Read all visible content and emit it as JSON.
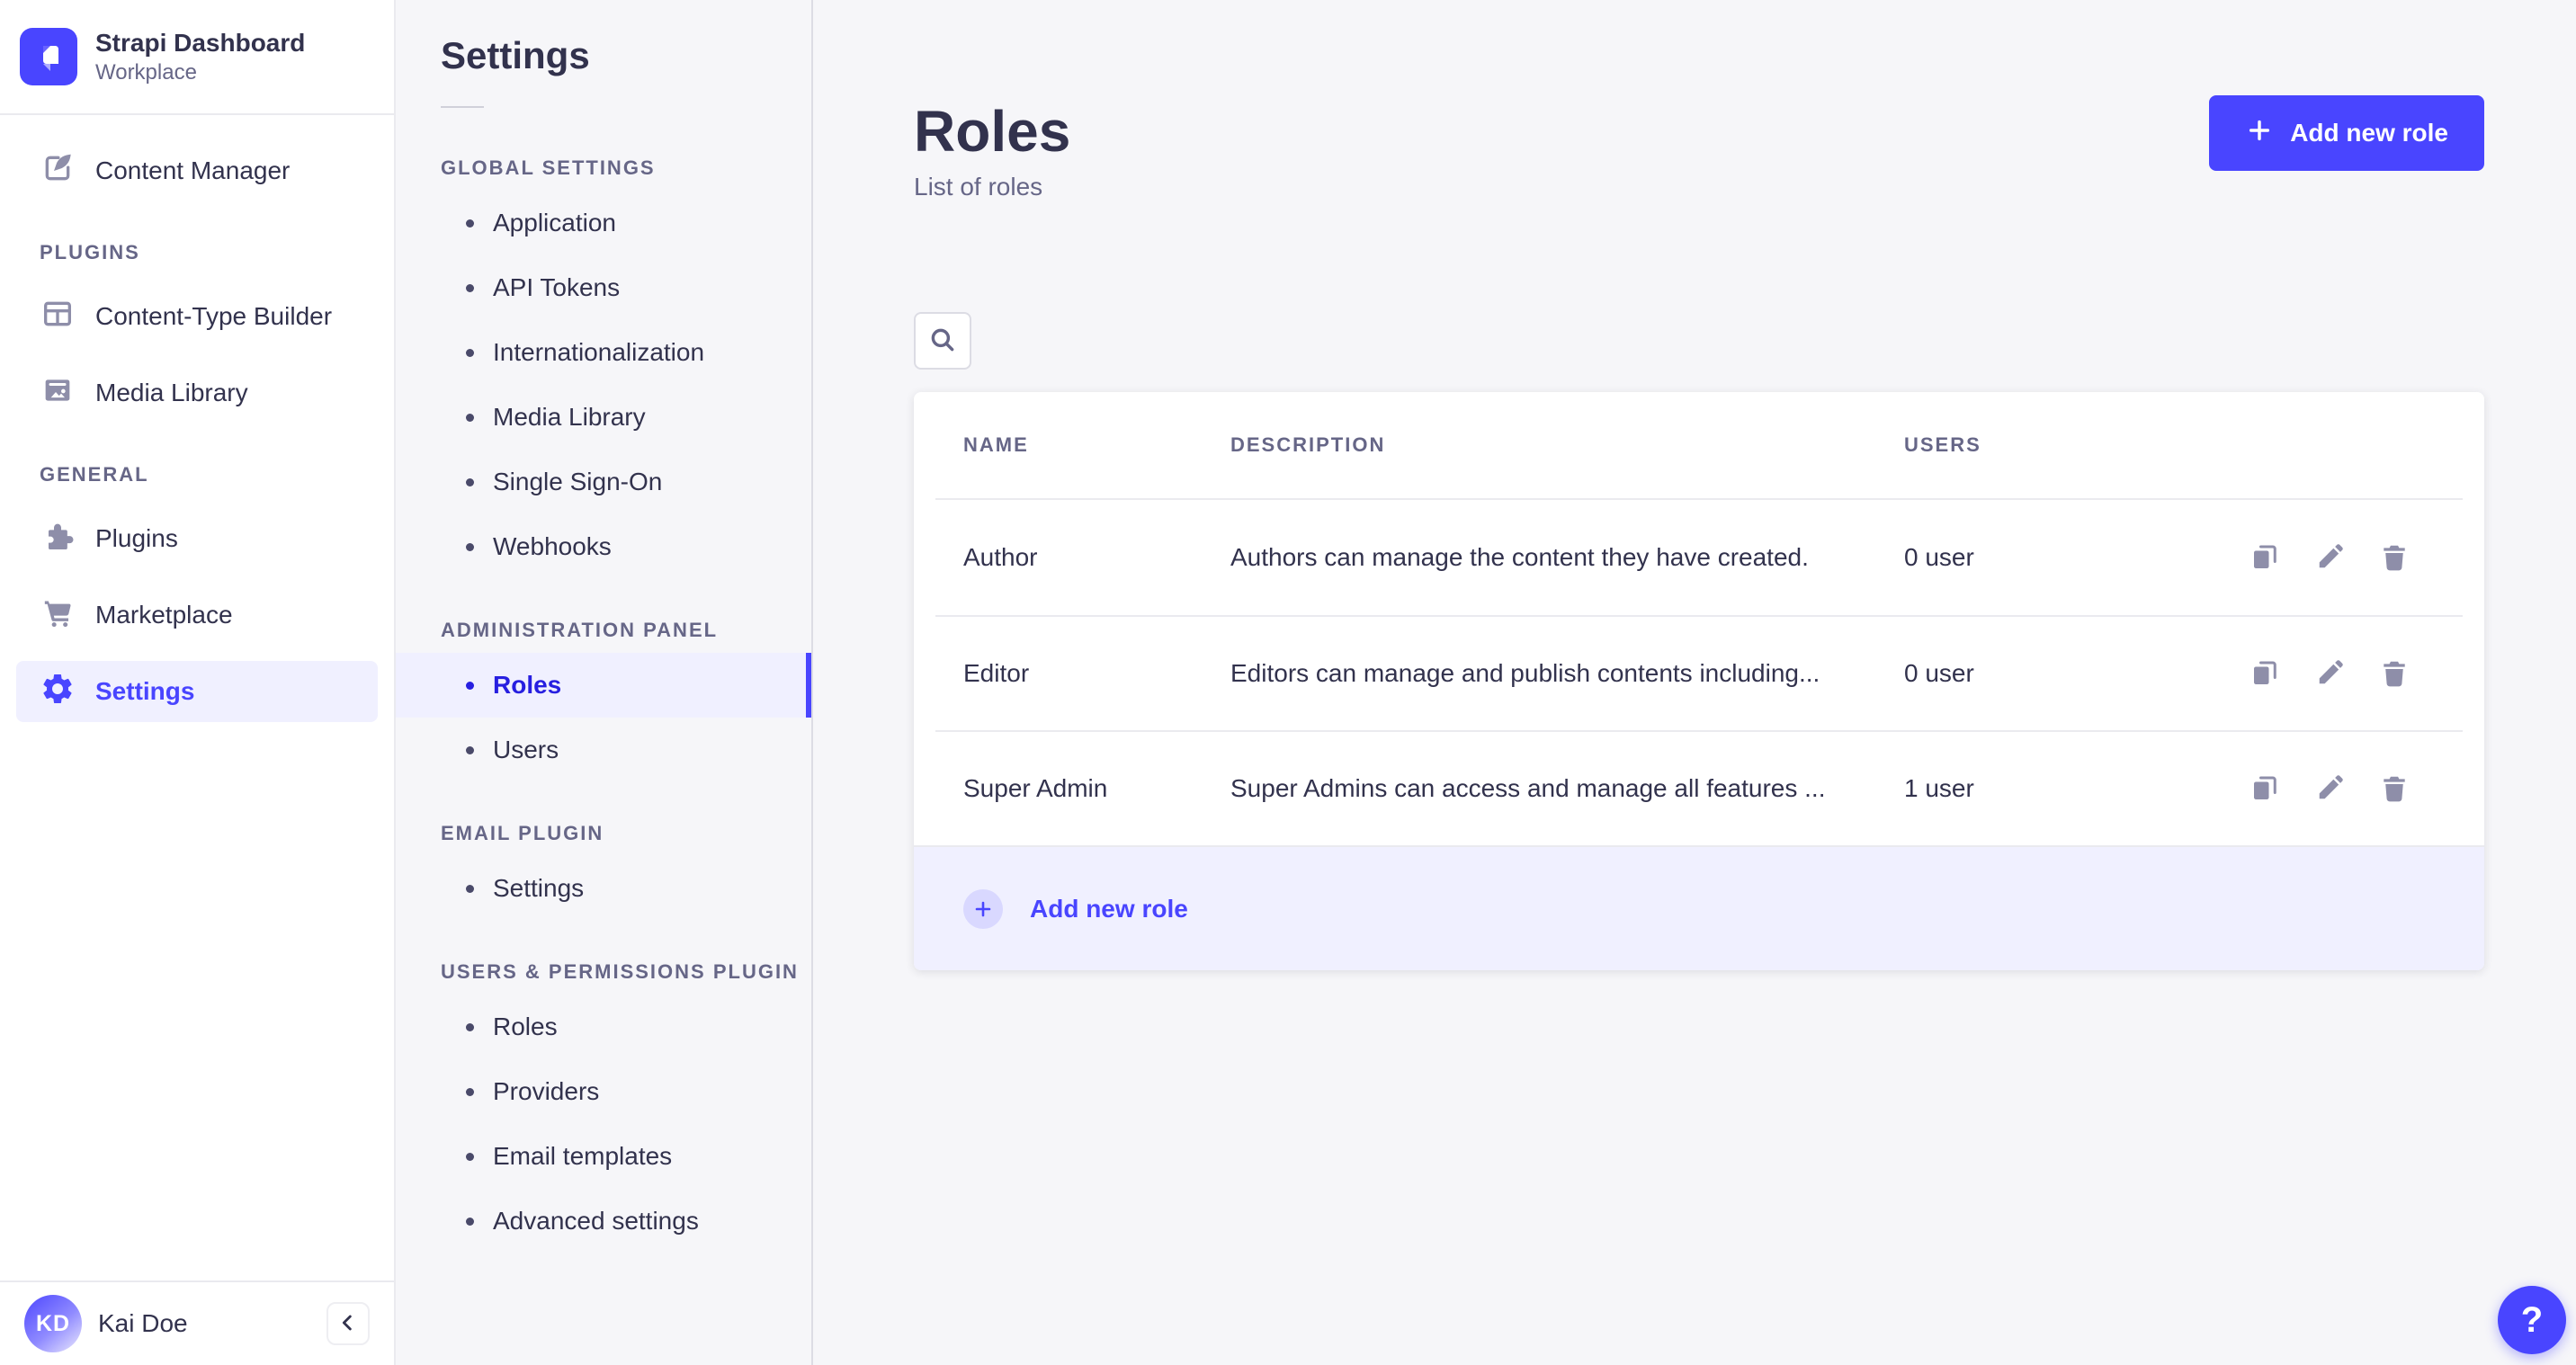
{
  "colors": {
    "accent": "#4945ff",
    "accent_dark": "#271fe0",
    "accent_light_bg": "#f0f0ff",
    "app_bg": "#f6f6f9",
    "card_bg": "#ffffff",
    "text": "#32324d",
    "text_muted": "#666687",
    "icon_muted": "#8e8ea9",
    "border": "#eaeaef"
  },
  "brand": {
    "title": "Strapi Dashboard",
    "subtitle": "Workplace"
  },
  "main_nav": {
    "content_manager": "Content Manager",
    "sections": [
      {
        "label": "PLUGINS",
        "items": [
          "Content-Type Builder",
          "Media Library"
        ]
      },
      {
        "label": "GENERAL",
        "items": [
          "Plugins",
          "Marketplace",
          "Settings"
        ]
      }
    ],
    "active_item": "Settings",
    "user": {
      "initials": "KD",
      "name": "Kai Doe"
    }
  },
  "sub_nav": {
    "title": "Settings",
    "sections": [
      {
        "label": "GLOBAL SETTINGS",
        "items": [
          "Application",
          "API Tokens",
          "Internationalization",
          "Media Library",
          "Single Sign-On",
          "Webhooks"
        ]
      },
      {
        "label": "ADMINISTRATION PANEL",
        "items": [
          "Roles",
          "Users"
        ],
        "active_item": "Roles"
      },
      {
        "label": "EMAIL PLUGIN",
        "items": [
          "Settings"
        ]
      },
      {
        "label": "USERS & PERMISSIONS PLUGIN",
        "items": [
          "Roles",
          "Providers",
          "Email templates",
          "Advanced settings"
        ]
      }
    ]
  },
  "page": {
    "title": "Roles",
    "subtitle": "List of roles",
    "add_button_label": "Add new role",
    "help_label": "?"
  },
  "table": {
    "headers": [
      "NAME",
      "DESCRIPTION",
      "USERS"
    ],
    "rows": [
      {
        "name": "Author",
        "description": "Authors can manage the content they have created.",
        "users": "0 user"
      },
      {
        "name": "Editor",
        "description": "Editors can manage and publish contents including...",
        "users": "0 user"
      },
      {
        "name": "Super Admin",
        "description": "Super Admins can access and manage all features ...",
        "users": "1 user"
      }
    ],
    "footer_label": "Add new role"
  }
}
